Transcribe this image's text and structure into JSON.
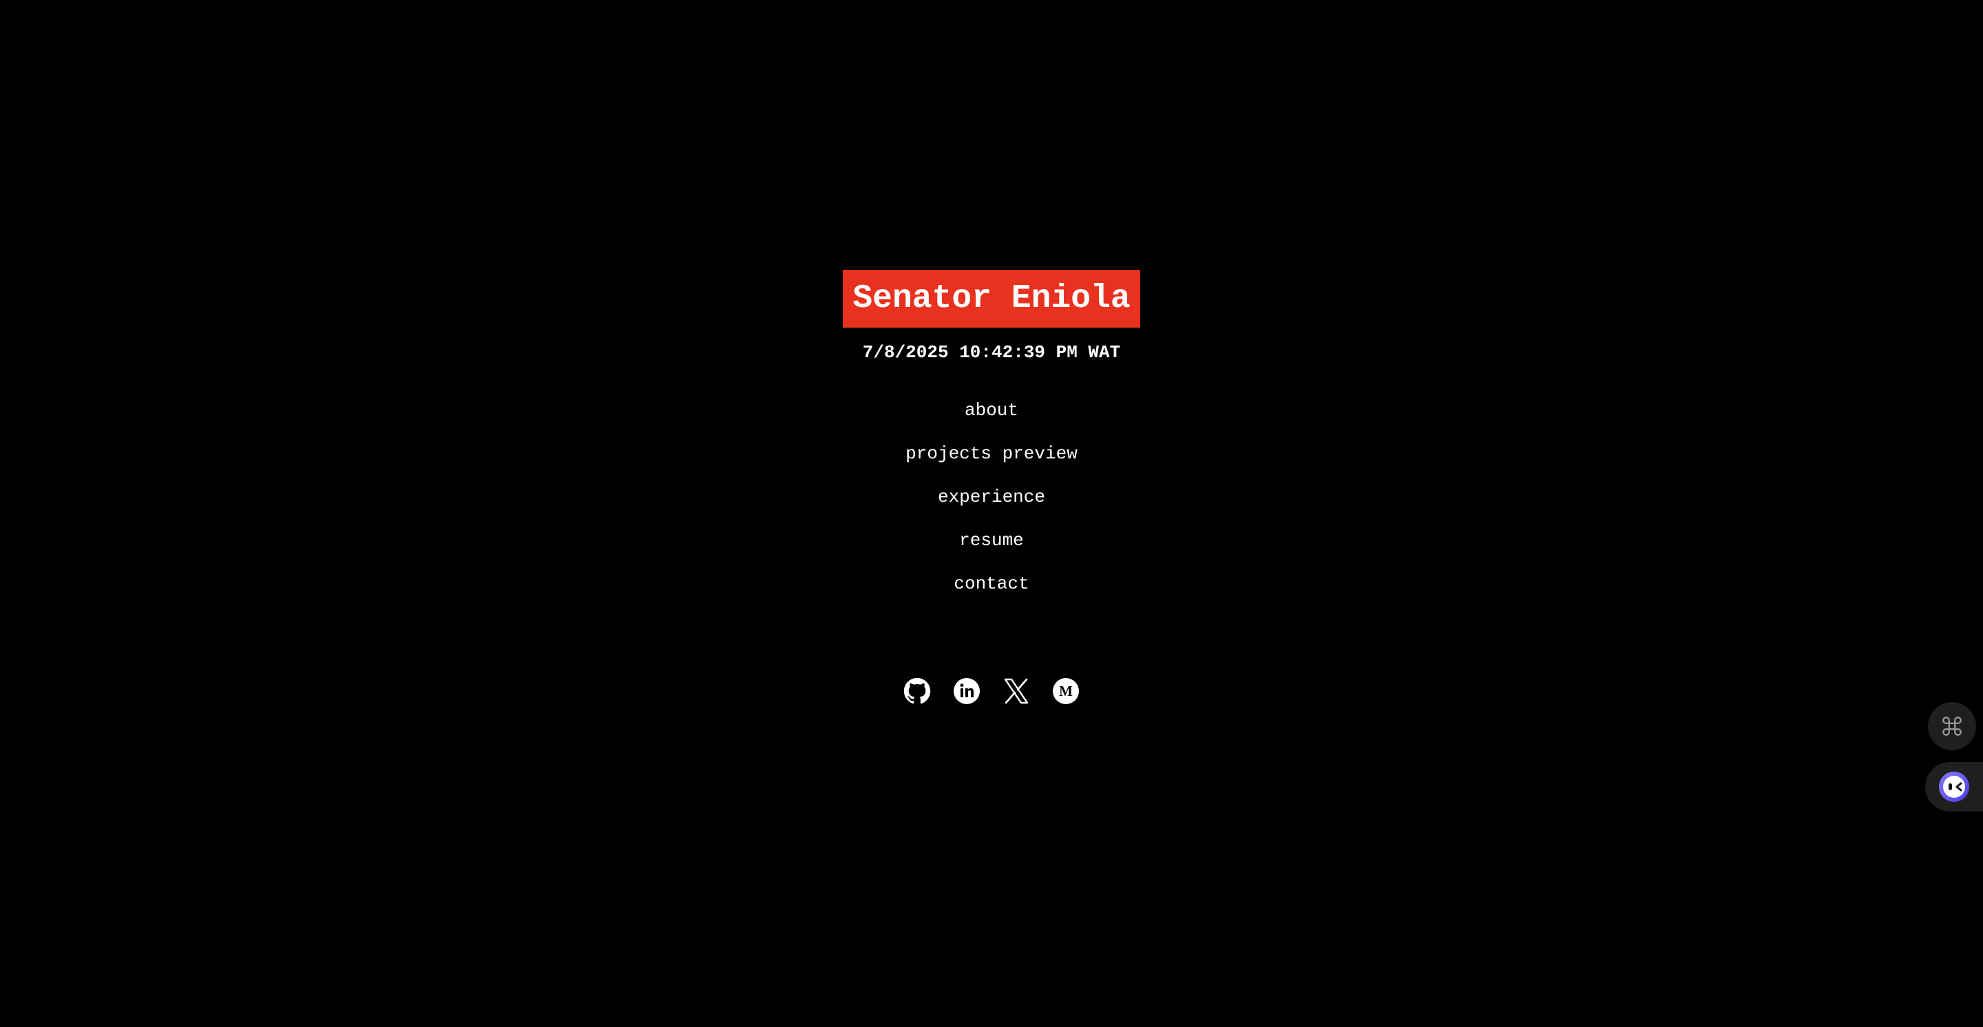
{
  "header": {
    "name": "Senator Eniola",
    "datetime": "7/8/2025 10:42:39 PM WAT"
  },
  "nav": {
    "items": [
      "about",
      "projects preview",
      "experience",
      "resume",
      "contact"
    ]
  },
  "social": {
    "icons": [
      "github-icon",
      "linkedin-icon",
      "x-icon",
      "medium-icon"
    ]
  },
  "floating": {
    "icons": [
      "command-icon",
      "assistant-icon"
    ]
  },
  "colors": {
    "background": "#000000",
    "accent": "#e8321f",
    "text": "#ffffff",
    "fab": "#1f1f1f",
    "assistant": "#6d5cf6"
  }
}
